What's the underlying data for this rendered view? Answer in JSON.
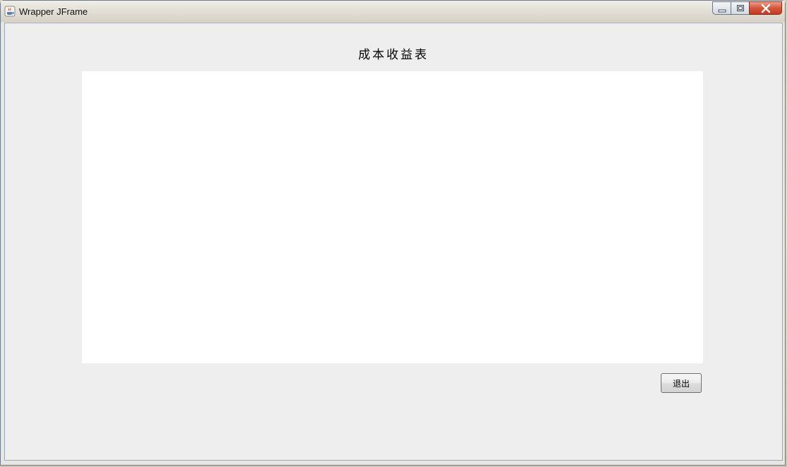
{
  "window": {
    "title": "Wrapper JFrame",
    "icon": "java-cup-icon",
    "controls": {
      "minimize_icon": "minimize-icon",
      "maximize_icon": "maximize-icon",
      "close_icon": "close-icon"
    }
  },
  "main": {
    "heading": "成本收益表",
    "exit_label": "退出"
  },
  "colors": {
    "client_bg": "#eeeeee",
    "panel_bg": "#ffffff",
    "close_button": "#c9432a"
  }
}
